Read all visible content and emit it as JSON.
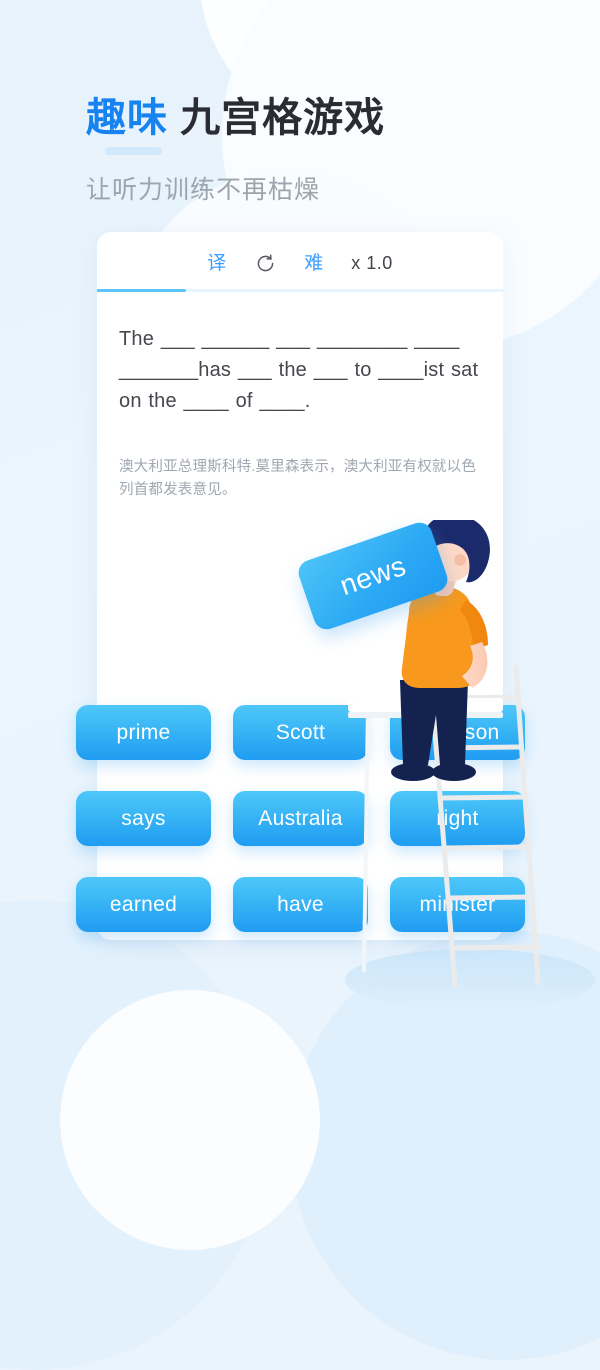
{
  "header": {
    "title_accent": "趣味",
    "title_rest": "九宫格游戏",
    "subtitle": "让听力训练不再枯燥"
  },
  "card": {
    "toolbar": {
      "translate_label": "译",
      "refresh_icon": "refresh-icon",
      "difficulty_label": "难",
      "speed_label": "x 1.0"
    },
    "progress": {
      "percent": 22
    },
    "passage": "The ___ ______ ___ ________ ____ _______has ___ the ___ to ____ist sat on the ____ of ____.",
    "translation": "澳大利亚总理斯科特.莫里森表示，澳大利亚有权就以色列首都发表意见。"
  },
  "grid": {
    "tiles": [
      {
        "label": "prime"
      },
      {
        "label": "Scott"
      },
      {
        "label": "Morrison"
      },
      {
        "label": "says"
      },
      {
        "label": "Australia"
      },
      {
        "label": "right"
      },
      {
        "label": "earned"
      },
      {
        "label": "have"
      },
      {
        "label": "minister"
      }
    ]
  },
  "illustration": {
    "held_tile_label": "news",
    "character": "person-on-ladder",
    "ladder": "ladder"
  },
  "colors": {
    "accent_blue": "#1683f0",
    "tile_blue_light": "#4ec7f8",
    "tile_blue_dark": "#209cf2",
    "toolbar_blue": "#3b9eff",
    "shirt_orange": "#f8991d",
    "hair_navy": "#1b2a6b",
    "background": "#eaf4fd"
  }
}
